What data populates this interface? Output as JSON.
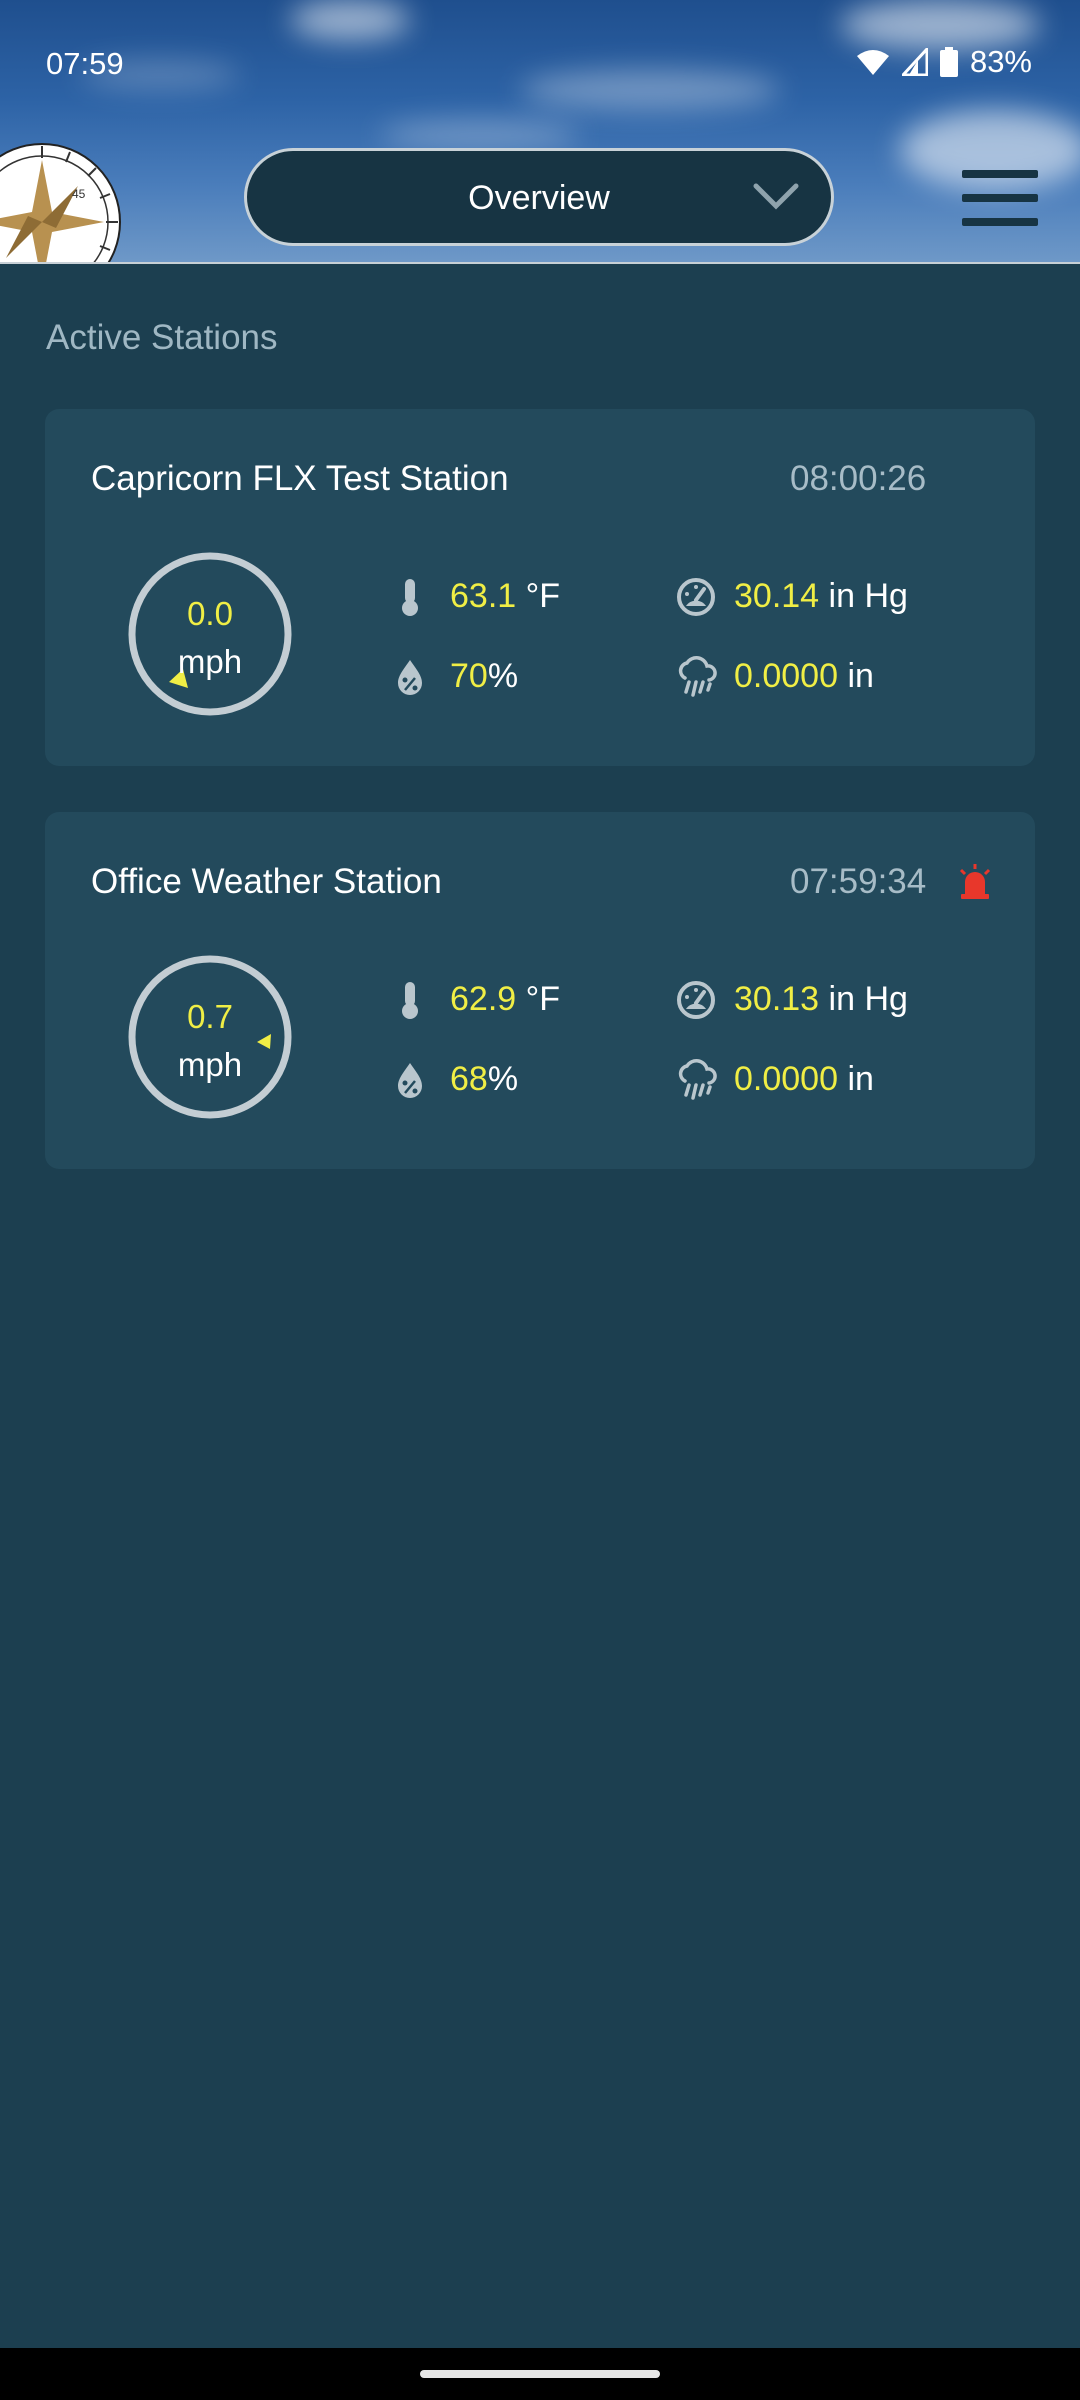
{
  "status_bar": {
    "time": "07:59",
    "battery": "83%"
  },
  "header": {
    "selector_label": "Overview"
  },
  "section_title": "Active Stations",
  "stations": [
    {
      "name": "Capricorn FLX Test Station",
      "time": "08:00:26",
      "wind_speed": "0.0",
      "wind_unit": "mph",
      "temperature": "63.1",
      "temperature_unit": "°F",
      "pressure": "30.14",
      "pressure_unit": "in Hg",
      "humidity": "70",
      "humidity_unit": "%",
      "rain": "0.0000",
      "rain_unit": "in"
    },
    {
      "name": "Office Weather Station",
      "time": "07:59:34",
      "wind_speed": "0.7",
      "wind_unit": "mph",
      "temperature": "62.9",
      "temperature_unit": "°F",
      "pressure": "30.13",
      "pressure_unit": "in Hg",
      "humidity": "68",
      "humidity_unit": "%",
      "rain": "0.0000",
      "rain_unit": "in",
      "alarm_icon": "alarm-siren-icon"
    }
  ],
  "colors": {
    "background": "#1c3f50",
    "card": "#234a5c",
    "value_yellow": "#f0ee45",
    "alarm_red": "#e8372b"
  }
}
